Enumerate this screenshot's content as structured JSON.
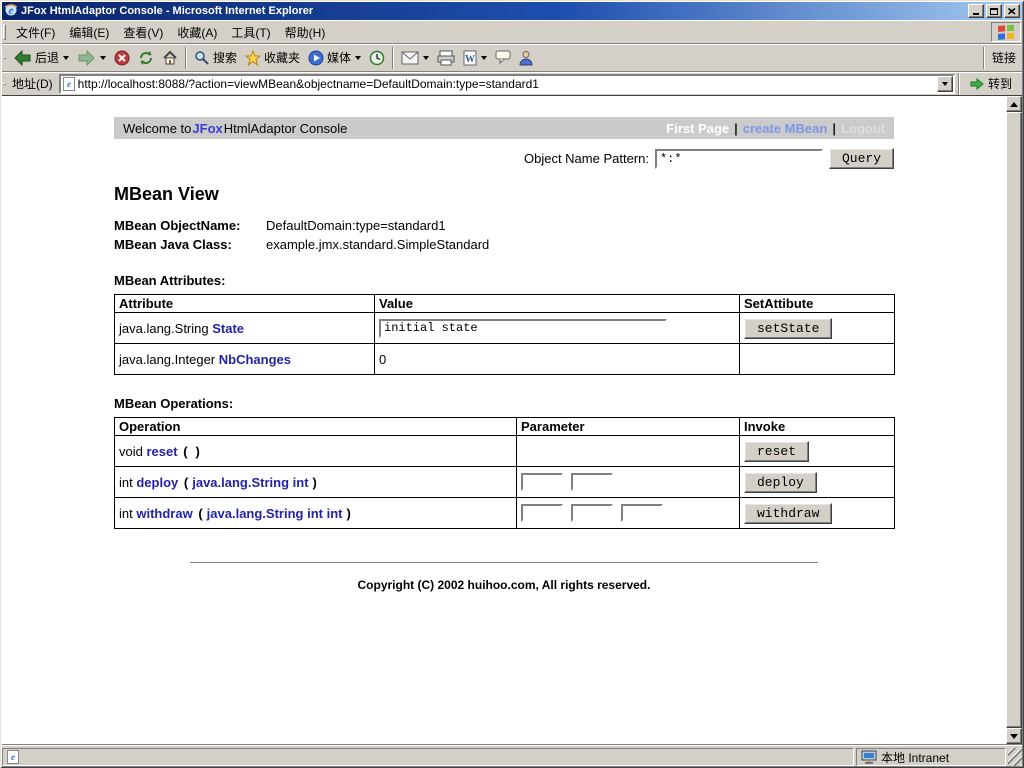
{
  "window": {
    "title": "JFox HtmlAdaptor Console - Microsoft Internet Explorer"
  },
  "menubar": {
    "items": [
      {
        "label": "文件(F)"
      },
      {
        "label": "编辑(E)"
      },
      {
        "label": "查看(V)"
      },
      {
        "label": "收藏(A)"
      },
      {
        "label": "工具(T)"
      },
      {
        "label": "帮助(H)"
      }
    ]
  },
  "toolbar": {
    "back_label": "后退",
    "search_label": "搜索",
    "favorites_label": "收藏夹",
    "media_label": "媒体",
    "links_label": "链接"
  },
  "addressbar": {
    "label": "地址(D)",
    "url": "http://localhost:8088/?action=viewMBean&objectname=DefaultDomain:type=standard1",
    "go_label": "转到"
  },
  "page": {
    "header": {
      "welcome_prefix": "Welcome to ",
      "brand": "JFox",
      "welcome_suffix": " HtmlAdaptor Console",
      "sep": "|",
      "links": [
        {
          "label": "First Page"
        },
        {
          "label": "create MBean"
        },
        {
          "label": "Logout"
        }
      ]
    },
    "query": {
      "label": "Object Name Pattern:",
      "value": "*:*",
      "button": "Query"
    },
    "title": "MBean View",
    "info": [
      {
        "label": "MBean ObjectName:",
        "value": "DefaultDomain:type=standard1"
      },
      {
        "label": "MBean Java Class:",
        "value": "example.jmx.standard.SimpleStandard"
      }
    ],
    "attributes": {
      "section_title": "MBean Attributes:",
      "headers": [
        "Attribute",
        "Value",
        "SetAttibute"
      ],
      "rows": [
        {
          "type": "java.lang.String",
          "name": "State",
          "value": "initial state",
          "button": "setState"
        },
        {
          "type": "java.lang.Integer",
          "name": "NbChanges",
          "value": "0"
        }
      ]
    },
    "operations": {
      "section_title": "MBean Operations:",
      "headers": [
        "Operation",
        "Parameter",
        "Invoke"
      ],
      "paren_open": "(",
      "paren_close": ")",
      "rows": [
        {
          "ret": "void",
          "name": "reset",
          "params": "",
          "button": "reset"
        },
        {
          "ret": "int",
          "name": "deploy",
          "params": "java.lang.String int",
          "button": "deploy"
        },
        {
          "ret": "int",
          "name": "withdraw",
          "params": "java.lang.String int int",
          "button": "withdraw"
        }
      ]
    },
    "footer": "Copyright (C) 2002 huihoo.com, All rights reserved."
  },
  "statusbar": {
    "zone": "本地 Intranet"
  }
}
